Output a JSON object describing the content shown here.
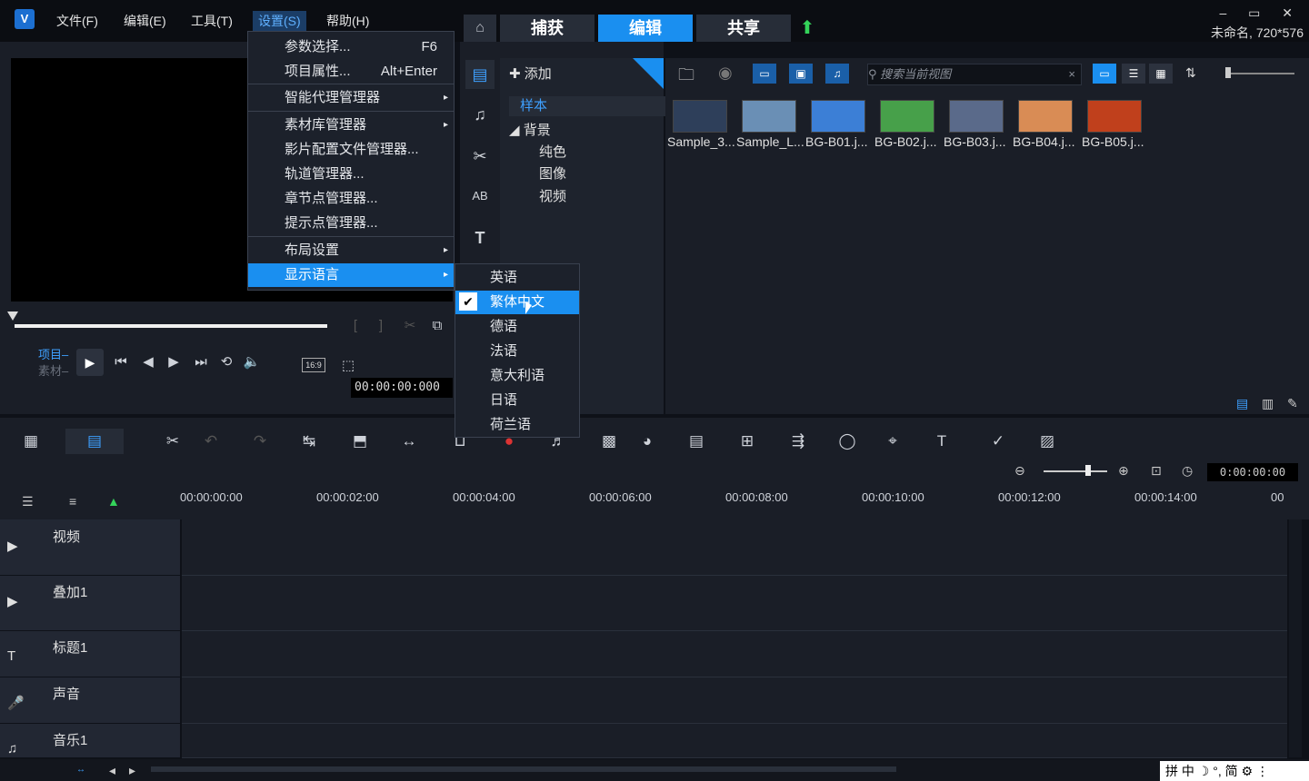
{
  "app": {
    "logo": "V"
  },
  "menubar": [
    "文件(F)",
    "编辑(E)",
    "工具(T)",
    "设置(S)",
    "帮助(H)"
  ],
  "tabs": [
    "捕获",
    "编辑",
    "共享"
  ],
  "window": {
    "controls": "– ▭ ✕",
    "project_info": "未命名, 720*576"
  },
  "player": {
    "label_project": "项目–",
    "label_clip": "素材–",
    "timecode": "00:00:00:000",
    "aspect": "16:9"
  },
  "library": {
    "add_label": "添加",
    "tree": {
      "sample": "样本",
      "background": "背景",
      "children": [
        "纯色",
        "图像",
        "视频"
      ]
    },
    "search_placeholder": "搜索当前视图",
    "thumbs": [
      {
        "label": "Sample_3...",
        "color": "#2e3f5a"
      },
      {
        "label": "Sample_L...",
        "color": "#6a8fb5"
      },
      {
        "label": "BG-B01.j...",
        "color": "#3c7fd6"
      },
      {
        "label": "BG-B02.j...",
        "color": "#47a04a"
      },
      {
        "label": "BG-B03.j...",
        "color": "#5a6a8a"
      },
      {
        "label": "BG-B04.j...",
        "color": "#d98c55"
      },
      {
        "label": "BG-B05.j...",
        "color": "#c0401c"
      }
    ]
  },
  "menu_settings": {
    "items": [
      {
        "label": "参数选择...",
        "shortcut": "F6"
      },
      {
        "label": "项目属性...",
        "shortcut": "Alt+Enter"
      },
      {
        "label": "智能代理管理器",
        "sub": "▸"
      },
      {
        "label": "素材库管理器",
        "sub": "▸"
      },
      {
        "label": "影片配置文件管理器..."
      },
      {
        "label": "轨道管理器..."
      },
      {
        "label": "章节点管理器..."
      },
      {
        "label": "提示点管理器..."
      },
      {
        "label": "布局设置",
        "sub": "▸"
      },
      {
        "label": "显示语言",
        "sub": "▸"
      }
    ]
  },
  "menu_language": {
    "items": [
      "英语",
      "繁体中文",
      "德语",
      "法语",
      "意大利语",
      "日语",
      "荷兰语"
    ],
    "checked": "✔"
  },
  "timeline": {
    "zoom_timecode": "0:00:00:00",
    "ruler": [
      "00:00:00:00",
      "00:00:02:00",
      "00:00:04:00",
      "00:00:06:00",
      "00:00:08:00",
      "00:00:10:00",
      "00:00:12:00",
      "00:00:14:00",
      "00"
    ],
    "tracks": [
      "视频",
      "叠加1",
      "标题1",
      "声音",
      "音乐1"
    ]
  },
  "ime": "拼 中 ☽ °, 简 ⚙ ⋮",
  "colors": {
    "accent": "#1a8ff0",
    "bg": "#0e1118",
    "panel": "#1a1e27"
  }
}
